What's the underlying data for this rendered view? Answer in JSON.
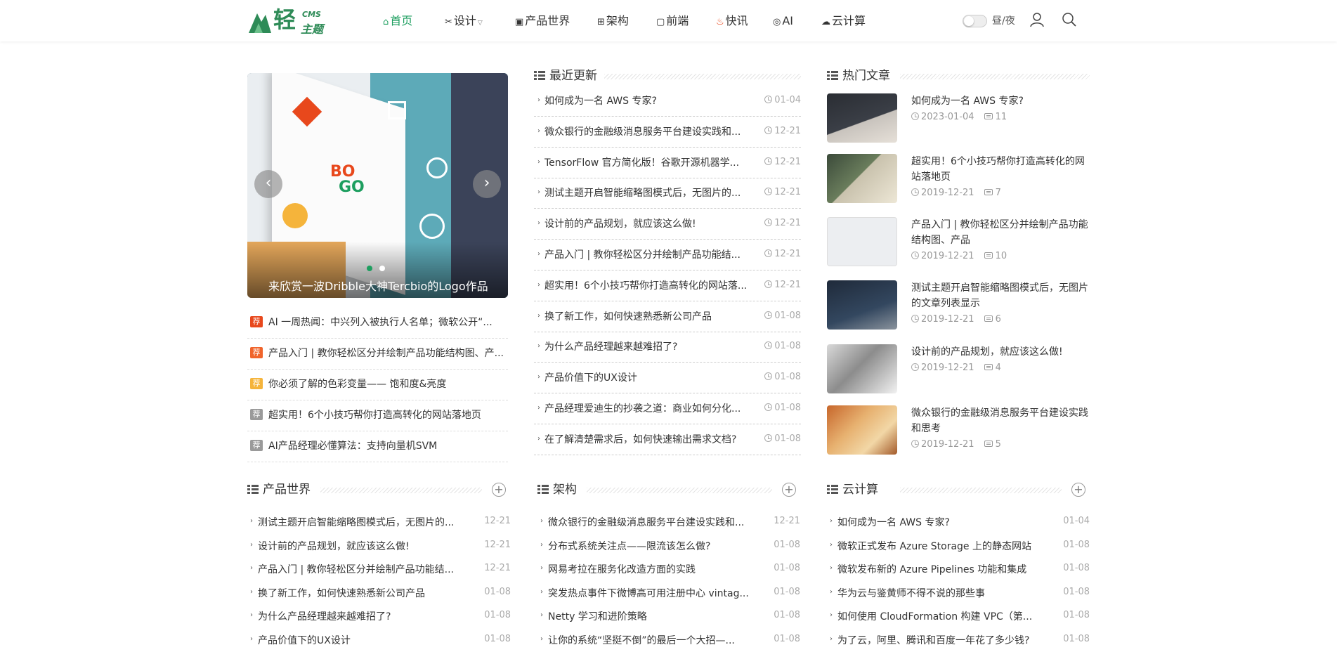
{
  "header": {
    "logo_char": "轻",
    "logo_cms": "CMS",
    "logo_sub": "主题",
    "nav": [
      {
        "label": "首页",
        "icon": "home-icon",
        "active": true
      },
      {
        "label": "设计",
        "icon": "design-icon",
        "dropdown": true
      },
      {
        "label": "产品世界",
        "icon": "product-icon"
      },
      {
        "label": "架构",
        "icon": "architecture-icon"
      },
      {
        "label": "前端",
        "icon": "frontend-icon"
      },
      {
        "label": "快讯",
        "icon": "fire-icon"
      },
      {
        "label": "AI",
        "icon": "ai-icon"
      },
      {
        "label": "云计算",
        "icon": "cloud-icon"
      }
    ],
    "theme_toggle_label": "昼/夜",
    "user_icon": "user-icon",
    "search_icon": "search-icon"
  },
  "slider": {
    "caption": "来欣赏一波Dribble大神Tercbio的Logo作品",
    "prev": "‹",
    "next": "›",
    "active_dot": 0
  },
  "recommended": [
    {
      "badge": "荐",
      "badge_color": "#e8481c",
      "title": "AI 一周热闻：中兴列入被执行人名单；微软公开“..."
    },
    {
      "badge": "荐",
      "badge_color": "#f0642b",
      "title": "产品入门 | 教你轻松区分并绘制产品功能结构图、产..."
    },
    {
      "badge": "荐",
      "badge_color": "#f5b43b",
      "title": "你必须了解的色彩变量—— 饱和度&亮度"
    },
    {
      "badge": "荐",
      "badge_color": "#9a9a9a",
      "title": "超实用！6个小技巧帮你打造高转化的网站落地页"
    },
    {
      "badge": "荐",
      "badge_color": "#9a9a9a",
      "title": "AI产品经理必懂算法：支持向量机SVM"
    }
  ],
  "latest": {
    "heading": "最近更新",
    "items": [
      {
        "title": "如何成为一名 AWS 专家?",
        "date": "01-04"
      },
      {
        "title": "微众银行的金融级消息服务平台建设实践和...",
        "date": "12-21"
      },
      {
        "title": "TensorFlow 官方简化版！谷歌开源机器学...",
        "date": "12-21"
      },
      {
        "title": "测试主题开启智能缩略图模式后，无图片的...",
        "date": "12-21"
      },
      {
        "title": "设计前的产品规划，就应该这么做!",
        "date": "12-21"
      },
      {
        "title": "产品入门 | 教你轻松区分并绘制产品功能结...",
        "date": "12-21"
      },
      {
        "title": "超实用！6个小技巧帮你打造高转化的网站落...",
        "date": "12-21"
      },
      {
        "title": "换了新工作，如何快速熟悉新公司产品",
        "date": "01-08"
      },
      {
        "title": "为什么产品经理越来越难招了?",
        "date": "01-08"
      },
      {
        "title": "产品价值下的UX设计",
        "date": "01-08"
      },
      {
        "title": "产品经理爱迪生的抄袭之道：商业如何分化...",
        "date": "01-08"
      },
      {
        "title": "在了解清楚需求后，如何快速输出需求文档?",
        "date": "01-08"
      }
    ]
  },
  "hot": {
    "heading": "热门文章",
    "items": [
      {
        "title": "如何成为一名 AWS 专家?",
        "date": "2023-01-04",
        "comments": "11",
        "thumb": "laptop"
      },
      {
        "title": "超实用！6个小技巧帮你打造高转化的网站落地页",
        "date": "2019-12-21",
        "comments": "7",
        "thumb": "website"
      },
      {
        "title": "产品入门 | 教你轻松区分并绘制产品功能结构图、产品",
        "date": "2019-12-21",
        "comments": "10",
        "thumb": "wireframe"
      },
      {
        "title": "测试主题开启智能缩略图模式后，无图片的文章列表显示",
        "date": "2019-12-21",
        "comments": "6",
        "thumb": "code"
      },
      {
        "title": "设计前的产品规划，就应该这么做!",
        "date": "2019-12-21",
        "comments": "4",
        "thumb": "sketch"
      },
      {
        "title": "微众银行的金融级消息服务平台建设实践和思考",
        "date": "2019-12-21",
        "comments": "5",
        "thumb": "cards"
      }
    ]
  },
  "sections": [
    {
      "heading": "产品世界",
      "items": [
        {
          "title": "测试主题开启智能缩略图模式后，无图片的...",
          "date": "12-21"
        },
        {
          "title": "设计前的产品规划，就应该这么做!",
          "date": "12-21"
        },
        {
          "title": "产品入门 | 教你轻松区分并绘制产品功能结...",
          "date": "12-21"
        },
        {
          "title": "换了新工作，如何快速熟悉新公司产品",
          "date": "01-08"
        },
        {
          "title": "为什么产品经理越来越难招了?",
          "date": "01-08"
        },
        {
          "title": "产品价值下的UX设计",
          "date": "01-08"
        }
      ]
    },
    {
      "heading": "架构",
      "items": [
        {
          "title": "微众银行的金融级消息服务平台建设实践和...",
          "date": "12-21"
        },
        {
          "title": "分布式系统关注点——限流该怎么做?",
          "date": "01-08"
        },
        {
          "title": "网易考拉在服务化改造方面的实践",
          "date": "01-08"
        },
        {
          "title": "突发热点事件下微博高可用注册中心 vintag...",
          "date": "01-08"
        },
        {
          "title": "Netty 学习和进阶策略",
          "date": "01-08"
        },
        {
          "title": "让你的系统“坚挺不倒”的最后一个大招—...",
          "date": "01-08"
        }
      ]
    },
    {
      "heading": "云计算",
      "items": [
        {
          "title": "如何成为一名 AWS 专家?",
          "date": "01-04"
        },
        {
          "title": "微软正式发布 Azure Storage 上的静态网站",
          "date": "01-08"
        },
        {
          "title": "微软发布新的 Azure Pipelines 功能和集成",
          "date": "01-08"
        },
        {
          "title": "华为云与鉴黄师不得不说的那些事",
          "date": "01-08"
        },
        {
          "title": "如何使用 CloudFormation 构建 VPC（第...",
          "date": "01-08"
        },
        {
          "title": "为了云，阿里、腾讯和百度一年花了多少钱?",
          "date": "01-08"
        }
      ]
    }
  ]
}
